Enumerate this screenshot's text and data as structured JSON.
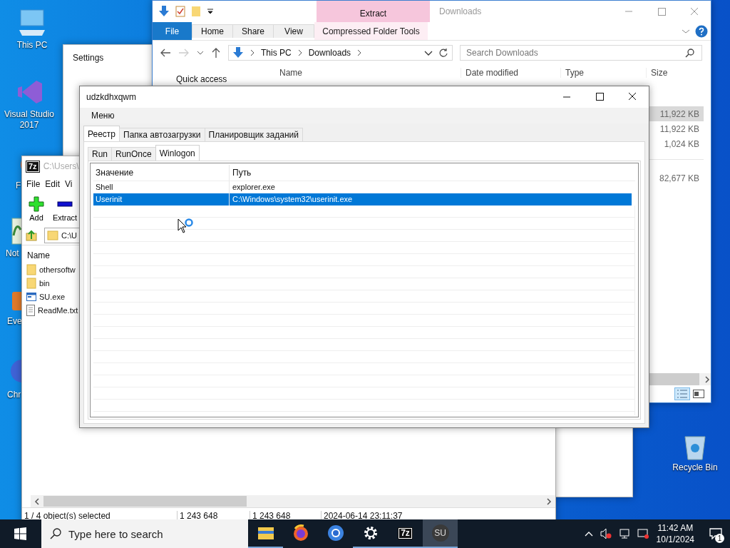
{
  "desktop_icons": [
    {
      "label": "This PC",
      "kind": "pc"
    },
    {
      "label": "Visual Studio 2017",
      "kind": "vs"
    },
    {
      "label": "F",
      "kind": "firefox"
    },
    {
      "label": "Not",
      "kind": "notepad"
    },
    {
      "label": "Eve",
      "kind": "generic"
    },
    {
      "label": "Chr",
      "kind": "chrome"
    },
    {
      "label": "Recycle Bin",
      "kind": "bin"
    }
  ],
  "settings_window": {
    "title": "Settings"
  },
  "explorer": {
    "title": "Downloads",
    "context_group": "Extract",
    "ribbon_tabs": [
      {
        "label": "File",
        "kind": "file"
      },
      {
        "label": "Home",
        "kind": "tab"
      },
      {
        "label": "Share",
        "kind": "tab"
      },
      {
        "label": "View",
        "kind": "tab"
      },
      {
        "label": "Compressed Folder Tools",
        "kind": "context"
      }
    ],
    "path": [
      "This PC",
      "Downloads"
    ],
    "search": {
      "placeholder": "Search Downloads"
    },
    "columns": [
      "Name",
      "Date modified",
      "Type",
      "Size"
    ],
    "nav_items": [
      "Quick access"
    ],
    "groups": [
      {
        "rows": [
          {
            "size": "11,922 KB",
            "selected": true
          },
          {
            "size": "11,922 KB",
            "selected": false
          },
          {
            "size": "1,024 KB",
            "selected": false
          }
        ]
      },
      {
        "rows": [
          {
            "size": "82,677 KB",
            "selected": false
          }
        ]
      }
    ]
  },
  "sevenzip": {
    "badge": "7z",
    "title": "C:\\Users\\",
    "menu": [
      "File",
      "Edit",
      "Vi"
    ],
    "toolbar": [
      {
        "label": "Add",
        "kind": "add"
      },
      {
        "label": "Extract",
        "kind": "extract"
      }
    ],
    "path": "C:\\U",
    "column": "Name",
    "items": [
      {
        "name": "othersoftw",
        "kind": "folder"
      },
      {
        "name": "bin",
        "kind": "folder"
      },
      {
        "name": "SU.exe",
        "kind": "exe"
      },
      {
        "name": "ReadMe.txt",
        "kind": "text"
      }
    ],
    "status": [
      "1 / 4 object(s) selected",
      "1 243 648",
      "1 243 648",
      "2024-06-14 23:11:37"
    ]
  },
  "dialog": {
    "title": "udzkdhxqwm",
    "menu": [
      "Меню"
    ],
    "tabs": [
      {
        "label": "Реестр",
        "selected": true
      },
      {
        "label": "Папка автозагрузки",
        "selected": false
      },
      {
        "label": "Планировщик заданий",
        "selected": false
      }
    ],
    "subtabs": [
      {
        "label": "Run",
        "selected": false
      },
      {
        "label": "RunOnce",
        "selected": false
      },
      {
        "label": "Winlogon",
        "selected": true
      }
    ],
    "columns": [
      "Значение",
      "Путь"
    ],
    "rows": [
      {
        "name": "Shell",
        "path": "explorer.exe",
        "selected": false
      },
      {
        "name": "Userinit",
        "path": "C:\\Windows\\system32\\userinit.exe",
        "selected": true
      }
    ]
  },
  "taskbar": {
    "search": {
      "placeholder": "Type here to search"
    },
    "apps": [
      {
        "kind": "explorer",
        "running": true,
        "active": false
      },
      {
        "kind": "firefox",
        "running": false,
        "active": false
      },
      {
        "kind": "chrome",
        "running": false,
        "active": false
      },
      {
        "kind": "settings",
        "running": true,
        "active": false
      },
      {
        "kind": "sevenzip",
        "label": "7z",
        "running": true,
        "active": false
      },
      {
        "kind": "su",
        "label": "SU",
        "running": true,
        "active": true
      }
    ],
    "time": "11:42 AM",
    "date": "10/1/2024",
    "notifications": "1"
  }
}
